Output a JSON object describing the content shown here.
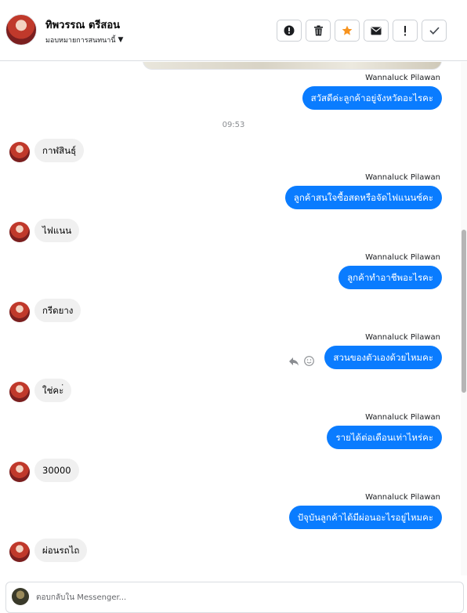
{
  "header": {
    "contact_name": "ทิพวรรณ ตรีสอน",
    "assign_label": "มอบหมายการสนทนานี้",
    "actions": [
      {
        "name": "report-button",
        "icon": "alert-circle-icon"
      },
      {
        "name": "delete-button",
        "icon": "trash-icon"
      },
      {
        "name": "star-button",
        "icon": "star-icon"
      },
      {
        "name": "mark-unread-button",
        "icon": "envelope-icon"
      },
      {
        "name": "important-button",
        "icon": "exclamation-icon"
      },
      {
        "name": "done-button",
        "icon": "check-icon"
      }
    ]
  },
  "conversation": {
    "agent_name": "Wannaluck Pilawan",
    "timestamp": "09:53",
    "messages": [
      {
        "from": "agent",
        "sender": "Wannaluck Pilawan",
        "text": "สวัสดีค่ะลูกค้าอยู่จังหวัดอะไรคะ"
      },
      {
        "from": "customer",
        "text": "กาฬสินธุ์"
      },
      {
        "from": "agent",
        "sender": "Wannaluck Pilawan",
        "text": "ลูกค้าสนใจซื้อสดหรือจัดไฟแนนซ์คะ"
      },
      {
        "from": "customer",
        "text": "ไฟแนน"
      },
      {
        "from": "agent",
        "sender": "Wannaluck Pilawan",
        "text": "ลูกค้าทำอาชีพอะไรคะ"
      },
      {
        "from": "customer",
        "text": "กรีดยาง"
      },
      {
        "from": "agent",
        "sender": "Wannaluck Pilawan",
        "text": "สวนของตัวเองด้วยไหมคะ"
      },
      {
        "from": "customer",
        "text": "ใช่คะ่"
      },
      {
        "from": "agent",
        "sender": "Wannaluck Pilawan",
        "text": "รายได้ต่อเดือนเท่าไหร่คะ"
      },
      {
        "from": "customer",
        "text": "30000"
      },
      {
        "from": "agent",
        "sender": "Wannaluck Pilawan",
        "text": "ปัจุบันลูกค้าได้มีผ่อนอะไรอยู่ไหมคะ"
      },
      {
        "from": "customer",
        "text": "ผ่อนรถไถ"
      }
    ]
  },
  "composer": {
    "placeholder": "ตอบกลับใน Messenger..."
  },
  "colors": {
    "agent_bubble": "#0a7cff",
    "customer_bubble": "#f0f0f0",
    "star_accent": "#f7931e"
  }
}
